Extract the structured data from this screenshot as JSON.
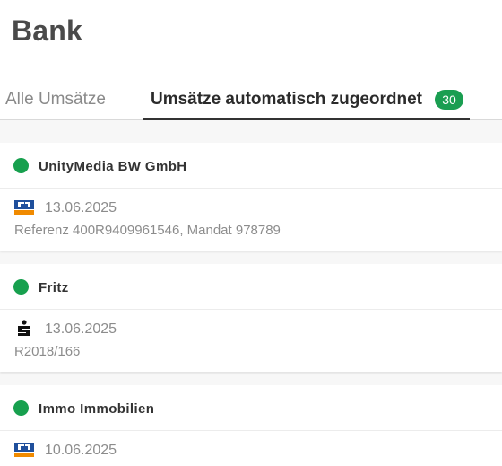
{
  "page": {
    "title": "Bank"
  },
  "tabs": {
    "all_label": "Alle Umsätze",
    "auto_label": "Umsätze automatisch zugeordnet",
    "auto_count": "30",
    "active": "auto"
  },
  "colors": {
    "status_dot": "#17a04e",
    "badge": "#1a9e51"
  },
  "groups": [
    {
      "name": "UnityMedia BW GmbH",
      "entry": {
        "icon": "volksbank-icon",
        "date": "13.06.2025",
        "reference": "Referenz 400R9409961546, Mandat 978789"
      }
    },
    {
      "name": "Fritz",
      "entry": {
        "icon": "sparkasse-icon",
        "date": "13.06.2025",
        "reference": "R2018/166"
      }
    },
    {
      "name": "Immo Immobilien",
      "entry": {
        "icon": "volksbank-icon",
        "date": "10.06.2025",
        "reference": ""
      }
    }
  ]
}
